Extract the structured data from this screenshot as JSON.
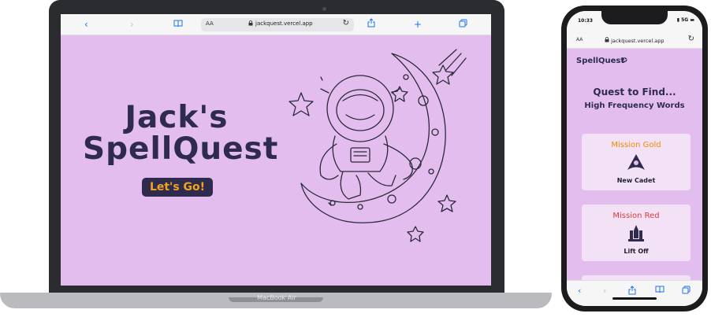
{
  "laptop": {
    "brand_label": "MacBook Air",
    "browser": {
      "aa_label": "AA",
      "url": "jackquest.vercel.app"
    },
    "hero": {
      "title_line1": "Jack's",
      "title_line2": "SpellQuest",
      "cta_label": "Let's Go!"
    }
  },
  "phone": {
    "status": {
      "time": "10:33",
      "network": "5G"
    },
    "browser": {
      "aa_label": "AA",
      "url": "jackquest.vercel.app"
    },
    "app": {
      "logo": "SpellQuest",
      "heading": "Quest to Find...",
      "subheading": "High Frequency Words",
      "missions": [
        {
          "title": "Mission Gold",
          "label": "New Cadet",
          "color": "#f08c00"
        },
        {
          "title": "Mission Red",
          "label": "Lift Off",
          "color": "#e03a3a"
        }
      ]
    }
  },
  "colors": {
    "background": "#e3bded",
    "navy": "#2e2b4e",
    "button_text": "#f3a41b",
    "browser_blue": "#1a73e8"
  },
  "icons": [
    "chevron-left-icon",
    "chevron-right-icon",
    "book-icon",
    "lock-icon",
    "reload-icon",
    "share-icon",
    "plus-icon",
    "tabs-icon",
    "star-icon",
    "starfleet-badge-icon",
    "space-shuttle-icon",
    "astronaut-on-moon-illustration"
  ]
}
